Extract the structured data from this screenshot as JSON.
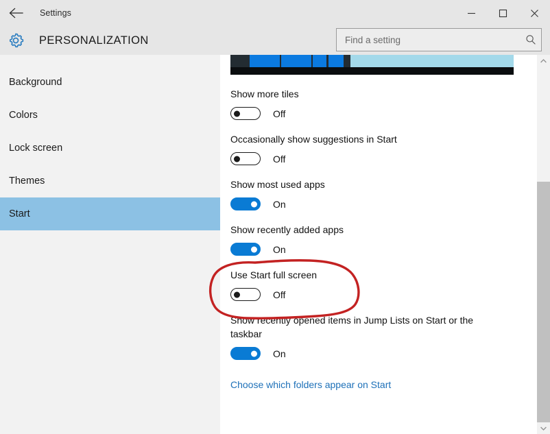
{
  "window": {
    "title": "Settings",
    "back_icon": "back-arrow-icon",
    "minimize_label": "─",
    "maximize_label": "□",
    "close_label": "✕"
  },
  "header": {
    "icon": "gear-icon",
    "title": "PERSONALIZATION"
  },
  "search": {
    "placeholder": "Find a setting",
    "value": "",
    "icon": "search-icon"
  },
  "sidebar": {
    "items": [
      {
        "label": "Background",
        "selected": false
      },
      {
        "label": "Colors",
        "selected": false
      },
      {
        "label": "Lock screen",
        "selected": false
      },
      {
        "label": "Themes",
        "selected": false
      },
      {
        "label": "Start",
        "selected": true
      }
    ],
    "selected_color": "#8cc1e4"
  },
  "preview": {
    "name": "start-preview-image",
    "background_dark": "#232c32",
    "background_light": "#a3d9ea",
    "tile_color": "#0b7ae0",
    "bottom_bar": "#0a0d0f"
  },
  "settings": [
    {
      "label": "Show more tiles",
      "state": "Off",
      "on": false
    },
    {
      "label": "Occasionally show suggestions in Start",
      "state": "Off",
      "on": false
    },
    {
      "label": "Show most used apps",
      "state": "On",
      "on": true
    },
    {
      "label": "Show recently added apps",
      "state": "On",
      "on": true
    },
    {
      "label": "Use Start full screen",
      "state": "Off",
      "on": false
    },
    {
      "label": "Show recently opened items in Jump Lists on Start or the taskbar",
      "state": "On",
      "on": true
    }
  ],
  "link": {
    "label": "Choose which folders appear on Start",
    "color": "#1d70b8"
  },
  "scrollbar": {
    "up_arrow": "▲",
    "down_arrow": "▼",
    "thumb_color": "#c0c0c0"
  },
  "annotation": {
    "name": "red-circle-annotation",
    "color": "#cc2222",
    "targets": "Use Start full screen"
  }
}
